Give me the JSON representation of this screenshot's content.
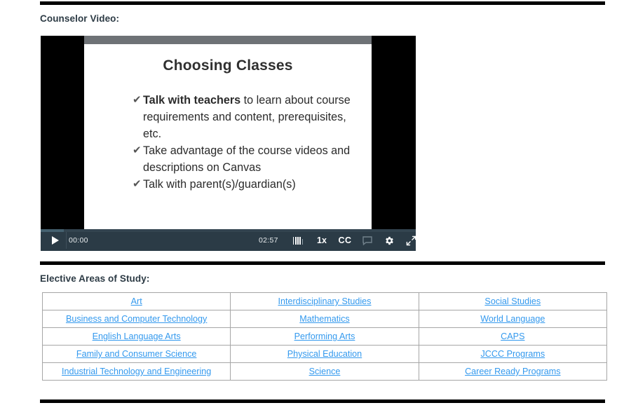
{
  "sections": {
    "video_heading": "Counselor Video:",
    "elective_heading": "Elective Areas of Study:"
  },
  "video": {
    "slide": {
      "title": "Choosing Classes",
      "bullets": [
        {
          "bold": "Talk with teachers",
          "rest": " to learn about course requirements and content, prerequisites, etc."
        },
        {
          "bold": "",
          "rest": "Take advantage of the course videos and descriptions on Canvas"
        },
        {
          "bold": "",
          "rest": "Talk with parent(s)/guardian(s)"
        }
      ],
      "check_glyph": "✔"
    },
    "controls": {
      "play_label": "play-button",
      "current_time": "00:00",
      "total_time": "02:57",
      "speed": "1x",
      "captions": "CC",
      "volume_icon": "volume-icon",
      "comment_icon": "comment-icon",
      "settings_icon": "settings-gear-icon",
      "fullscreen_icon": "fullscreen-icon"
    },
    "colors": {
      "control_bar": "#2b3b46",
      "letterbox": "#000000",
      "slide_topbar": "#6e7276"
    }
  },
  "elective_table": {
    "link_color": "#3399ee",
    "rows": [
      [
        "Art",
        "Interdisciplinary Studies",
        "Social Studies"
      ],
      [
        "Business and Computer Technology",
        "Mathematics",
        "World Language"
      ],
      [
        "English Language Arts",
        "Performing Arts",
        "CAPS"
      ],
      [
        "Family and Consumer Science",
        "Physical Education",
        "JCCC Programs"
      ],
      [
        "Industrial Technology and Engineering",
        "Science",
        "Career Ready Programs"
      ]
    ]
  }
}
